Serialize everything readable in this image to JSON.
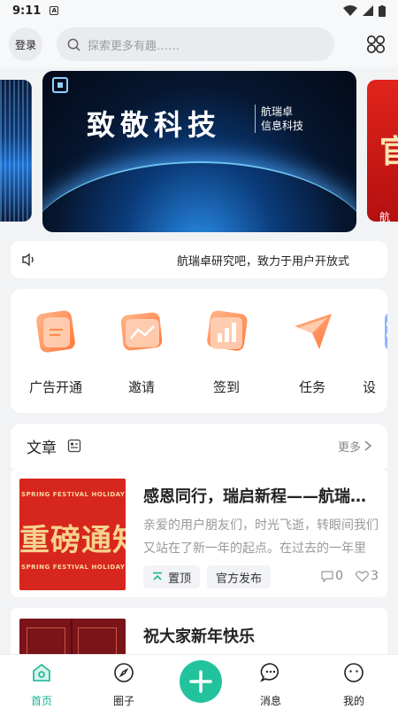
{
  "status_bar": {
    "time": "9:11"
  },
  "header": {
    "login_label": "登录",
    "search_placeholder": "探索更多有趣……"
  },
  "banner": {
    "title": "致敬科技",
    "brand_line1": "航瑞卓",
    "brand_line2": "信息科技",
    "right_partial_big": "官",
    "right_partial_small": "航"
  },
  "notice": {
    "text": "航瑞卓研究吧，致力于用户开放式"
  },
  "quick_actions": [
    {
      "label": "广告开通",
      "icon": "document-icon"
    },
    {
      "label": "邀请",
      "icon": "chart-line-icon"
    },
    {
      "label": "签到",
      "icon": "bar-chart-icon"
    },
    {
      "label": "任务",
      "icon": "send-icon"
    },
    {
      "label": "设",
      "icon": "settings-icon"
    }
  ],
  "articles_section": {
    "title": "文章",
    "more_label": "更多"
  },
  "articles": [
    {
      "title": "感恩同行，瑞启新程——航瑞卓信息科技",
      "desc": "亲爱的用户朋友们，时光飞逝，转眼间我们又站在了新一年的起点。在过去的一年里",
      "thumb_text": "重磅通知",
      "thumb_stripe": "SPRING FESTIVAL HOLIDAY NOTICE",
      "tag_pinned": "置顶",
      "tag_official": "官方发布",
      "comments": "0",
      "likes": "3"
    },
    {
      "title": "祝大家新年快乐"
    }
  ],
  "tabbar": {
    "home": "首页",
    "circle": "圈子",
    "messages": "消息",
    "mine": "我的"
  },
  "colors": {
    "accent": "#22c39c",
    "tab_active": "#19b394"
  }
}
